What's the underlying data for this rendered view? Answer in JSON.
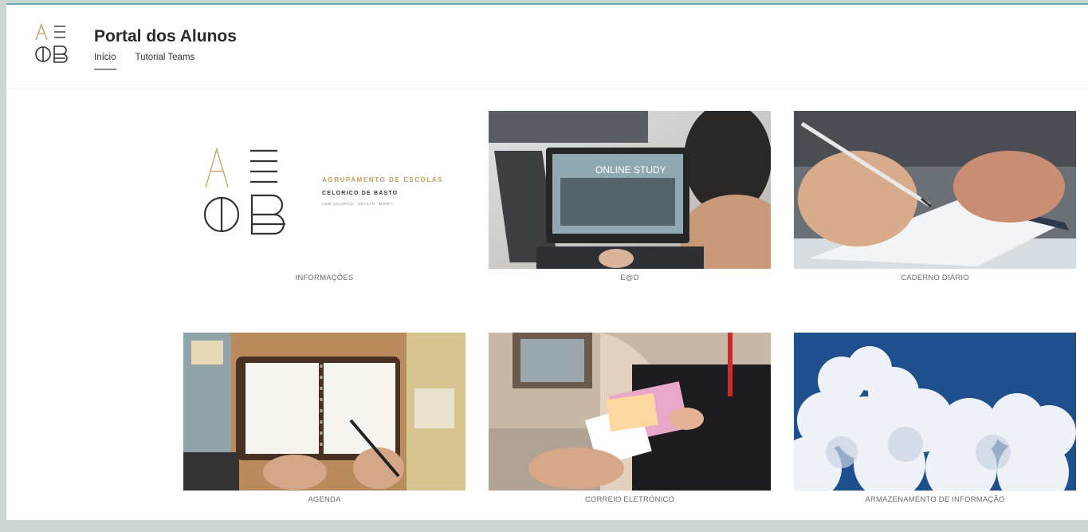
{
  "header": {
    "site_title": "Portal dos Alunos",
    "nav": [
      {
        "label": "Início",
        "active": true
      },
      {
        "label": "Tutorial Teams",
        "active": false
      }
    ]
  },
  "tiles": [
    {
      "label": "INFORMAÇÕES",
      "image": "school-logo"
    },
    {
      "label": "E@D",
      "image": "online-study-laptop",
      "image_text": "ONLINE STUDY"
    },
    {
      "label": "CADERNO DIÁRIO",
      "image": "writing-in-notebook"
    },
    {
      "label": "AGENDA",
      "image": "planner-binder"
    },
    {
      "label": "CORREIO ELETRÓNICO",
      "image": "mailbox-letters"
    },
    {
      "label": "ARMAZENAMENTO DE INFORMAÇÃO",
      "image": "clouds-sky"
    }
  ],
  "school_logo": {
    "line1": "AGRUPAMENTO DE ESCOLAS",
    "line2": "CELORICO DE BASTO",
    "line3": "COM CELORICO · DEACAN · MONFI"
  },
  "colors": {
    "accent": "#6fb0b8",
    "logo_gold": "#b99e5d",
    "sky": "#1f4f8c"
  }
}
